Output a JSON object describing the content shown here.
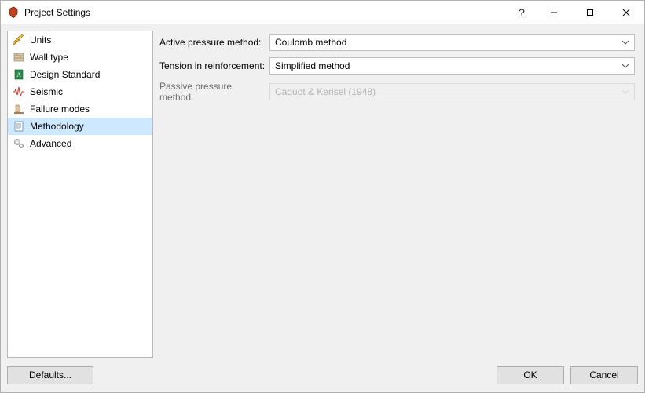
{
  "window": {
    "title": "Project Settings"
  },
  "sidebar": {
    "items": [
      {
        "label": "Units"
      },
      {
        "label": "Wall type"
      },
      {
        "label": "Design Standard"
      },
      {
        "label": "Seismic"
      },
      {
        "label": "Failure modes"
      },
      {
        "label": "Methodology"
      },
      {
        "label": "Advanced"
      }
    ],
    "selected_index": 5
  },
  "form": {
    "active_pressure": {
      "label": "Active pressure method:",
      "value": "Coulomb method"
    },
    "tension_reinforcement": {
      "label": "Tension in reinforcement:",
      "value": "Simplified method"
    },
    "passive_pressure": {
      "label": "Passive pressure method:",
      "value": "Caquot & Kerisel (1948)"
    }
  },
  "buttons": {
    "defaults": "Defaults...",
    "ok": "OK",
    "cancel": "Cancel"
  }
}
